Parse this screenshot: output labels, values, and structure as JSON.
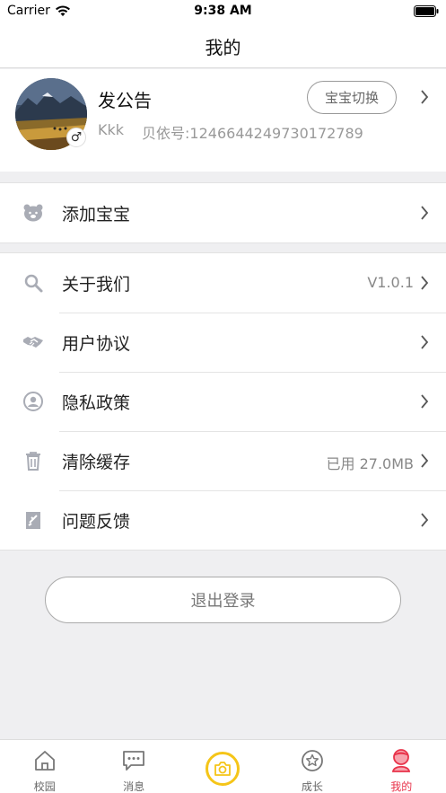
{
  "status": {
    "carrier": "Carrier",
    "time": "9:38 AM"
  },
  "nav": {
    "title": "我的"
  },
  "profile": {
    "name": "发公告",
    "nickname": "Kkk",
    "id_text": "贝依号:1246644249730172789",
    "gender_symbol": "♂",
    "switch_label": "宝宝切换"
  },
  "add_group": {
    "label": "添加宝宝"
  },
  "menu": [
    {
      "label": "关于我们",
      "value": "V1.0.1"
    },
    {
      "label": "用户协议",
      "value": ""
    },
    {
      "label": "隐私政策",
      "value": ""
    },
    {
      "label": "清除缓存",
      "value": "已用 27.0MB"
    },
    {
      "label": "问题反馈",
      "value": ""
    }
  ],
  "logout": {
    "label": "退出登录"
  },
  "tabs": [
    {
      "label": "校园",
      "icon": "home-icon"
    },
    {
      "label": "消息",
      "icon": "message-icon"
    },
    {
      "label": "",
      "icon": "camera-icon"
    },
    {
      "label": "成长",
      "icon": "star-icon"
    },
    {
      "label": "我的",
      "icon": "profile-icon"
    }
  ],
  "colors": {
    "accent": "#e8334a",
    "camera_ring": "#f5c518",
    "background": "#efeff1"
  }
}
